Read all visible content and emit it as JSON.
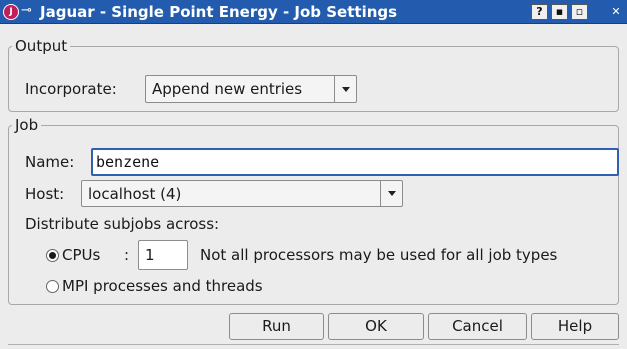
{
  "window": {
    "title": "Jaguar - Single Point Energy - Job Settings",
    "app_icon_letter": "J",
    "pin_glyph": "⊸",
    "title_buttons": [
      "?",
      "▪",
      "▫",
      "✕"
    ]
  },
  "output": {
    "legend": "Output",
    "incorporate_label": "Incorporate:",
    "incorporate_value": "Append new entries"
  },
  "job": {
    "legend": "Job",
    "name_label": "Name:",
    "name_value": "benzene",
    "host_label": "Host:",
    "host_value": "localhost (4)",
    "distribute_label": "Distribute subjobs across:",
    "cpus_label": "CPUs",
    "cpus_sep": ":",
    "cpus_value": "1",
    "cpus_note": "Not all processors may be used for all job types",
    "mpi_label": "MPI processes and threads",
    "selected": "cpus"
  },
  "buttons": {
    "run": "Run",
    "ok": "OK",
    "cancel": "Cancel",
    "help": "Help"
  }
}
